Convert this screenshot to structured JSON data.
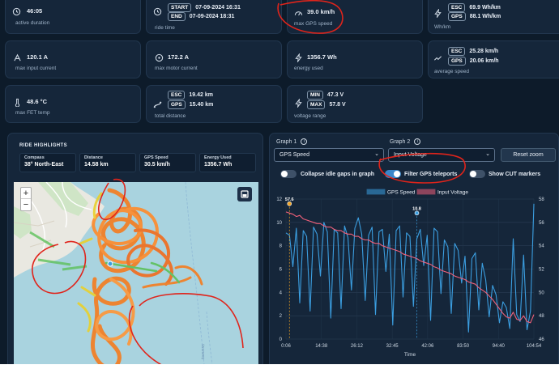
{
  "stats": {
    "active_duration": {
      "value": "46:05",
      "label": "active duration"
    },
    "ride_time": {
      "start_tag": "START",
      "start": "07-09-2024 16:31",
      "end_tag": "END",
      "end": "07-09-2024 18:31",
      "label": "ride time"
    },
    "max_gps_speed": {
      "value": "39.0 km/h",
      "label": "max GPS speed"
    },
    "wh_km": {
      "esc_tag": "ESC",
      "esc": "69.9 Wh/km",
      "gps_tag": "GPS",
      "gps": "88.1 Wh/km",
      "label": "Wh/km"
    },
    "max_input_current": {
      "value": "120.1 A",
      "label": "max input current"
    },
    "max_motor_current": {
      "value": "172.2 A",
      "label": "max motor current"
    },
    "energy_used": {
      "value": "1356.7 Wh",
      "label": "energy used"
    },
    "average_speed": {
      "esc_tag": "ESC",
      "esc": "25.28 km/h",
      "gps_tag": "GPS",
      "gps": "20.06 km/h",
      "label": "average speed"
    },
    "max_fet_temp": {
      "value": "48.6 °C",
      "label": "max FET temp"
    },
    "total_distance": {
      "esc_tag": "ESC",
      "esc": "19.42 km",
      "gps_tag": "GPS",
      "gps": "15.40 km",
      "label": "total distance"
    },
    "voltage_range": {
      "min_tag": "MIN",
      "min": "47.3 V",
      "max_tag": "MAX",
      "max": "57.8 V",
      "label": "voltage range"
    }
  },
  "highlights": {
    "title": "RIDE HIGHLIGHTS",
    "items": [
      {
        "label": "Compass",
        "value": "38° North-East"
      },
      {
        "label": "Distance",
        "value": "14.58 km"
      },
      {
        "label": "GPS Speed",
        "value": "30.5 km/h"
      },
      {
        "label": "Energy Used",
        "value": "1356.7 Wh"
      }
    ]
  },
  "map": {
    "zoom_in": "+",
    "zoom_out": "−",
    "street_label": "Stranweg"
  },
  "graph_panel": {
    "graph1_label": "Graph 1",
    "graph1_value": "GPS Speed",
    "graph2_label": "Graph 2",
    "graph2_value": "Input Voltage",
    "info_glyph": "i",
    "reset_label": "Reset zoom",
    "toggles": [
      {
        "label": "Collapse idle gaps in graph",
        "on": false
      },
      {
        "label": "Filter GPS teleports",
        "on": true
      },
      {
        "label": "Show CUT markers",
        "on": false
      }
    ]
  },
  "chart_data": {
    "type": "line",
    "xlabel": "Time",
    "x_ticks": [
      "0:06",
      "14:38",
      "26:12",
      "32:45",
      "42:06",
      "83:50",
      "94:40",
      "104:54"
    ],
    "y_left_ticks": [
      0,
      2,
      4,
      6,
      8,
      10,
      12
    ],
    "y_right_ticks": [
      46,
      48,
      50,
      52,
      54,
      56,
      58
    ],
    "ylim_left": [
      0,
      12
    ],
    "ylim_right": [
      46,
      58
    ],
    "legend_position": "top",
    "series": [
      {
        "name": "GPS Speed",
        "axis": "left",
        "color": "#3b9ee0",
        "values": [
          9.1,
          8.9,
          6.2,
          9.5,
          3.1,
          9.3,
          8.8,
          2.4,
          9.6,
          9.0,
          5.4,
          10.0,
          9.2,
          1.8,
          9.4,
          9.1,
          2.6,
          9.7,
          8.7,
          4.2,
          9.5,
          10.4,
          9.0,
          3.3,
          8.9,
          9.6,
          2.1,
          9.2,
          9.4,
          5.8,
          9.0,
          1.2,
          9.3,
          9.7,
          3.6,
          9.1,
          8.8,
          2.8,
          8.6,
          9.4,
          6.3,
          8.9,
          1.6,
          9.5,
          9.2,
          3.9,
          8.5,
          7.9,
          2.2,
          8.2,
          7.6,
          4.8,
          7.1,
          0.6,
          6.9,
          7.4,
          2.5,
          6.5,
          5.1,
          1.9,
          4.6,
          3.8,
          1.4,
          3.2,
          2.7,
          0.9,
          8.6,
          2.1,
          1.5,
          7.2,
          0.8,
          2.4,
          11.6
        ]
      },
      {
        "name": "Input Voltage",
        "axis": "right",
        "color": "#f0607a",
        "values": [
          56.9,
          56.8,
          56.7,
          56.5,
          56.6,
          56.3,
          56.2,
          56.1,
          56.0,
          55.9,
          55.9,
          55.7,
          55.6,
          55.6,
          55.4,
          55.3,
          55.3,
          55.1,
          55.0,
          55.0,
          54.8,
          54.8,
          54.6,
          54.5,
          54.5,
          54.3,
          54.2,
          54.2,
          54.0,
          53.9,
          53.8,
          53.7,
          53.6,
          53.5,
          53.3,
          53.2,
          53.1,
          53.0,
          52.9,
          52.7,
          52.6,
          52.5,
          52.4,
          52.2,
          52.1,
          51.9,
          51.8,
          51.7,
          51.6,
          51.4,
          51.3,
          51.2,
          51.1,
          50.9,
          50.8,
          50.7,
          50.4,
          50.2,
          50.0,
          49.7,
          49.4,
          49.0,
          48.6,
          48.2,
          47.9,
          47.8,
          48.3,
          47.7,
          47.6,
          48.0,
          47.5,
          47.4,
          48.1
        ]
      }
    ],
    "annotations": [
      {
        "text": "57.6",
        "x_index": 1,
        "series": "Input Voltage",
        "value": 57.6,
        "color": "#f5a623"
      },
      {
        "text": "10.8",
        "x_index": 38,
        "series": "GPS Speed",
        "value": 10.8,
        "color": "#3b9ee0"
      }
    ]
  }
}
